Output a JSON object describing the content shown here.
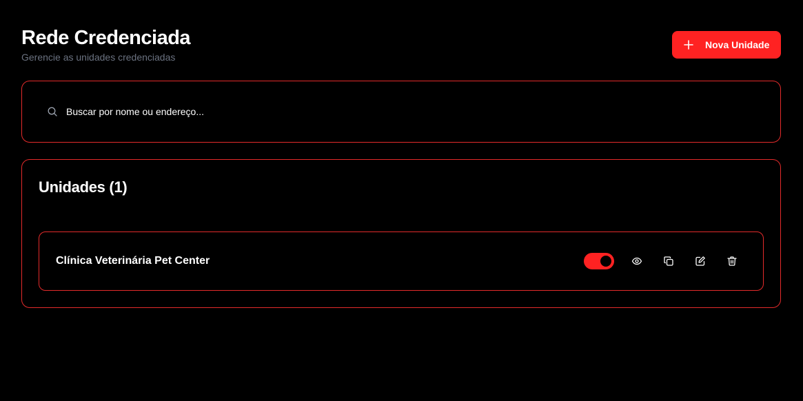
{
  "header": {
    "title": "Rede Credenciada",
    "subtitle": "Gerencie as unidades credenciadas",
    "new_button_label": "Nova Unidade",
    "new_button_icon": "plus-icon"
  },
  "search": {
    "placeholder": "Buscar por nome ou endereço...",
    "value": "",
    "icon": "search-icon"
  },
  "units": {
    "title": "Unidades (1)",
    "items": [
      {
        "name": "Clínica Veterinária Pet Center",
        "active": true,
        "actions": [
          "eye-icon",
          "copy-icon",
          "edit-icon",
          "trash-icon"
        ]
      }
    ]
  },
  "colors": {
    "background": "#000000",
    "accent": "#ff2222",
    "border": "#e52b2b",
    "muted_text": "#6b7280"
  }
}
